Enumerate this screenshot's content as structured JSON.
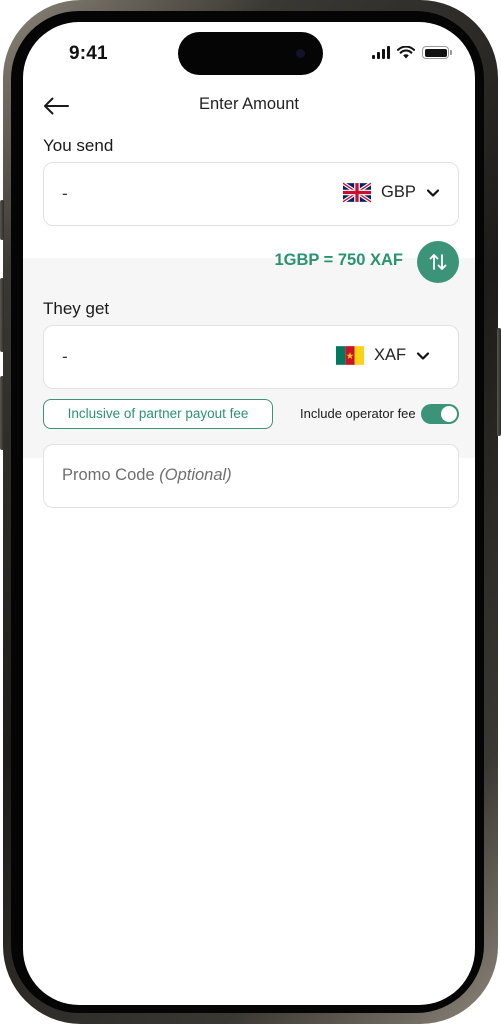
{
  "status_bar": {
    "time": "9:41"
  },
  "header": {
    "title": "Enter Amount"
  },
  "send": {
    "label": "You send",
    "amount": "-",
    "currency": "GBP",
    "flag": "uk-flag-icon"
  },
  "exchange": {
    "rate_text": "1GBP = 750 XAF"
  },
  "receive": {
    "label": "They get",
    "amount": "-",
    "currency": "XAF",
    "flag": "cameroon-flag-icon"
  },
  "fees": {
    "partner_fee_badge": "Inclusive of partner payout fee",
    "operator_fee_label": "Include operator fee",
    "operator_fee_enabled": true
  },
  "promo": {
    "placeholder_main": "Promo Code",
    "placeholder_optional": "(Optional)"
  },
  "colors": {
    "accent": "#3b9477",
    "accent_text": "#2a9470",
    "rate_band_bg": "#f6f6f6",
    "border": "#e2e2e2"
  }
}
